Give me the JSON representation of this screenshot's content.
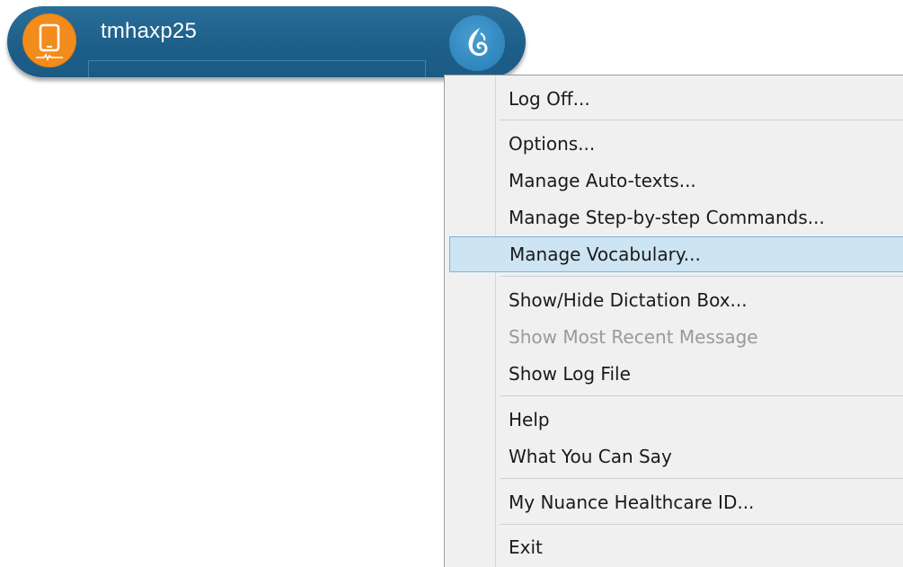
{
  "toolbar": {
    "user_name": "tmhaxp25",
    "mic_icon": "mobile-phone-icon",
    "dragon_icon": "dragon-logo-icon",
    "colors": {
      "bar": "#1d5f89",
      "mic_button": "#f28c1c",
      "dragon_button": "#2f86bd"
    }
  },
  "menu": {
    "items": [
      {
        "label": "Log Off...",
        "enabled": true
      },
      {
        "label": "Options...",
        "enabled": true
      },
      {
        "label": "Manage Auto-texts...",
        "enabled": true
      },
      {
        "label": "Manage Step-by-step Commands...",
        "enabled": true
      },
      {
        "label": "Manage Vocabulary...",
        "enabled": true,
        "highlighted": true
      },
      {
        "label": "Show/Hide Dictation Box...",
        "enabled": true
      },
      {
        "label": "Show Most Recent Message",
        "enabled": false
      },
      {
        "label": "Show Log File",
        "enabled": true
      },
      {
        "label": "Help",
        "enabled": true
      },
      {
        "label": "What You Can Say",
        "enabled": true
      },
      {
        "label": "My Nuance Healthcare ID...",
        "enabled": true
      },
      {
        "label": "Exit",
        "enabled": true
      }
    ],
    "highlight_color": "#cde4f3"
  }
}
